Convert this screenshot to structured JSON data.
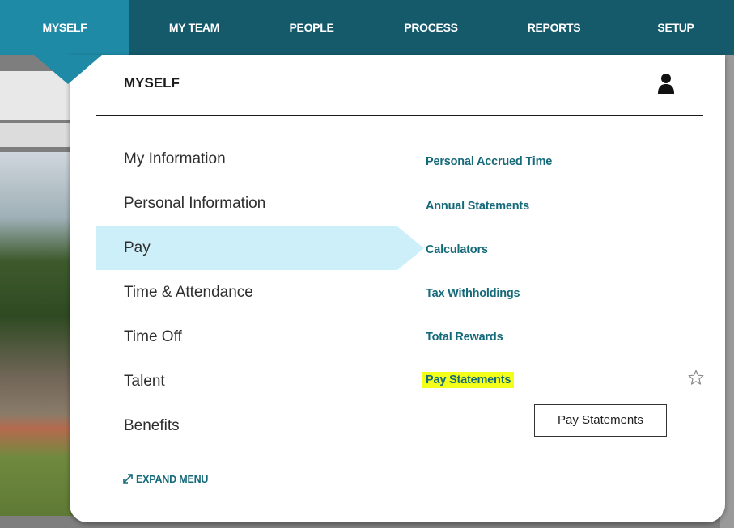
{
  "nav": {
    "items": [
      {
        "label": "MYSELF"
      },
      {
        "label": "MY TEAM"
      },
      {
        "label": "PEOPLE"
      },
      {
        "label": "PROCESS"
      },
      {
        "label": "REPORTS"
      },
      {
        "label": "SETUP"
      }
    ],
    "active": "MYSELF"
  },
  "panel": {
    "title": "MYSELF",
    "left_items": [
      {
        "label": "My Information"
      },
      {
        "label": "Personal Information"
      },
      {
        "label": "Pay"
      },
      {
        "label": "Time & Attendance"
      },
      {
        "label": "Time Off"
      },
      {
        "label": "Talent"
      },
      {
        "label": "Benefits"
      }
    ],
    "selected_left_item": "Pay",
    "right_links": [
      {
        "label": "Personal Accrued Time"
      },
      {
        "label": "Annual Statements"
      },
      {
        "label": "Calculators"
      },
      {
        "label": "Tax Withholdings"
      },
      {
        "label": "Total Rewards"
      },
      {
        "label": "Pay Statements"
      }
    ],
    "highlighted_link": "Pay Statements",
    "tooltip": "Pay Statements",
    "expand_label": "EXPAND MENU"
  },
  "colors": {
    "nav_bg": "#155a6b",
    "nav_active": "#1f8aa6",
    "link": "#156a7a",
    "selected_bg": "#cdeff9",
    "highlight": "#f3ff18"
  },
  "icons": {
    "user": "user-icon",
    "star": "star-outline-icon",
    "expand": "expand-arrows-icon"
  }
}
